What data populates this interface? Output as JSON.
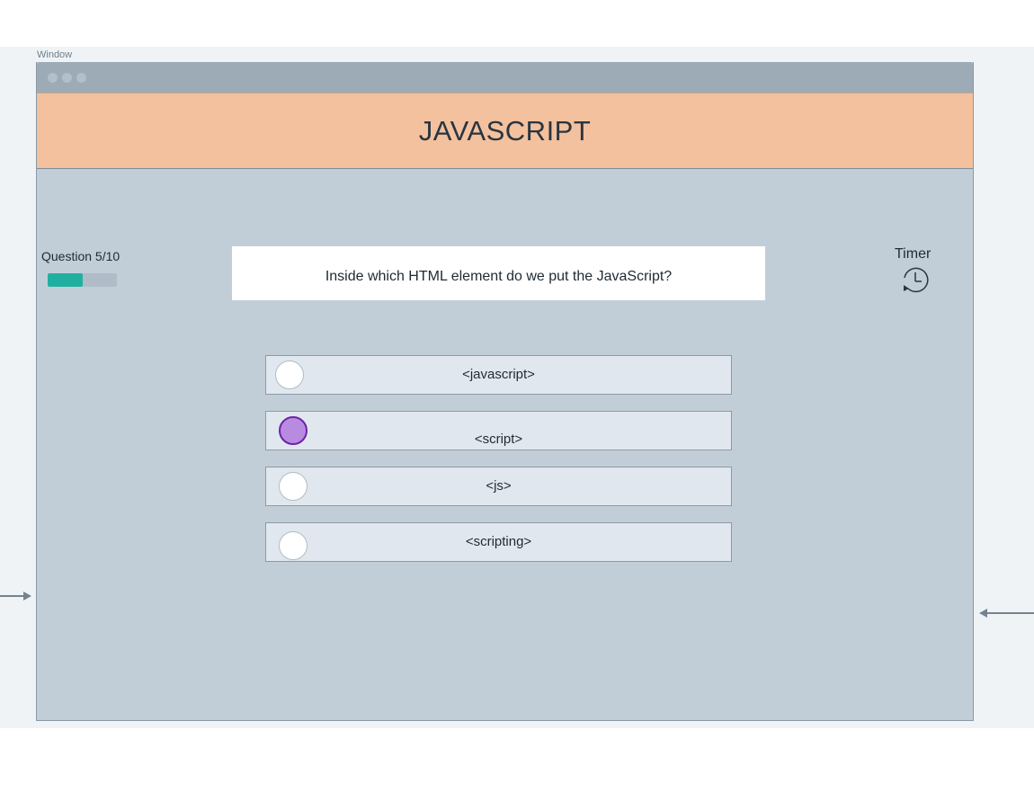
{
  "window": {
    "label": "Window"
  },
  "header": {
    "title": "JAVASCRIPT"
  },
  "progress": {
    "label": "Question 5/10",
    "fraction": 0.5,
    "fill_color": "#21b0a0"
  },
  "question": {
    "text": "Inside which HTML element do we put the JavaScript?"
  },
  "timer": {
    "label": "Timer",
    "icon": "clock-history-icon"
  },
  "options": [
    {
      "label": "<javascript>",
      "selected": false
    },
    {
      "label": "<script>",
      "selected": true
    },
    {
      "label": "<js>",
      "selected": false
    },
    {
      "label": "<scripting>",
      "selected": false
    }
  ],
  "colors": {
    "header_bg": "#f3c19e",
    "content_bg": "#c2ced7",
    "option_bg": "#e1e7ee",
    "selected_radio": "#b98be0"
  }
}
